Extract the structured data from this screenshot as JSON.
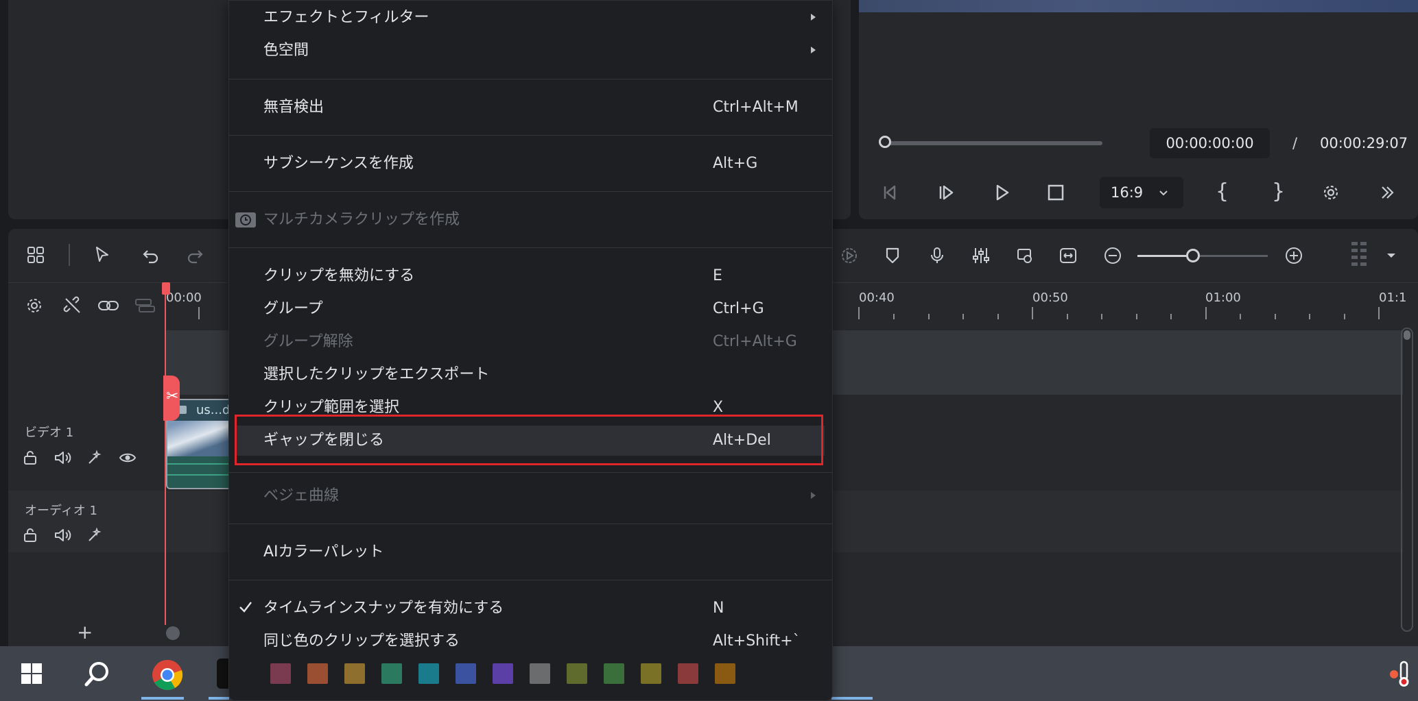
{
  "player": {
    "current_time": "00:00:00:00",
    "separator": "/",
    "total_time": "00:00:29:07",
    "aspect_ratio": "16:9",
    "progress": 0
  },
  "ruler": {
    "labels": [
      "00:00",
      "00:40",
      "00:50",
      "01:00",
      "01:1"
    ]
  },
  "tracks": {
    "video_label": "ビデオ 1",
    "audio_label": "オーディオ 1",
    "clip_title": "us...de"
  },
  "context_menu": {
    "items": [
      {
        "label": "エフェクトとフィルター",
        "shortcut": "",
        "submenu": true
      },
      {
        "label": "色空間",
        "shortcut": "",
        "submenu": true
      },
      {
        "label": "無音検出",
        "shortcut": "Ctrl+Alt+M"
      },
      {
        "label": "サブシーケンスを作成",
        "shortcut": "Alt+G"
      },
      {
        "label": "マルチカメラクリップを作成",
        "shortcut": "",
        "disabled": true
      },
      {
        "label": "クリップを無効にする",
        "shortcut": "E"
      },
      {
        "label": "グループ",
        "shortcut": "Ctrl+G"
      },
      {
        "label": "グループ解除",
        "shortcut": "Ctrl+Alt+G",
        "disabled": true
      },
      {
        "label": "選択したクリップをエクスポート",
        "shortcut": ""
      },
      {
        "label": "クリップ範囲を選択",
        "shortcut": "X"
      },
      {
        "label": "ギャップを閉じる",
        "shortcut": "Alt+Del",
        "highlighted": true
      },
      {
        "label": "ベジェ曲線",
        "shortcut": "",
        "disabled": true,
        "submenu": true
      },
      {
        "label": "AIカラーパレット",
        "shortcut": ""
      },
      {
        "label": "タイムラインスナップを有効にする",
        "shortcut": "N",
        "checked": true
      },
      {
        "label": "同じ色のクリップを選択する",
        "shortcut": "Alt+Shift+`"
      }
    ],
    "color_swatches": [
      "#7a3a4f",
      "#9a4e32",
      "#8e6f2e",
      "#2b7a60",
      "#1a7b8c",
      "#3a52a0",
      "#5b3fa6",
      "#6b6c6e",
      "#5e6b2c",
      "#3a6e3a",
      "#7a7126",
      "#8a3a3a",
      "#8a5a12"
    ]
  },
  "colors": {
    "highlight_border": "#e0262a",
    "playhead": "#f0575d",
    "accent_clip": "#3ea384"
  },
  "taskbar": {
    "icons": [
      "windows-start-icon",
      "search-icon",
      "chrome-icon",
      "app-icon",
      "weather-icon"
    ]
  }
}
